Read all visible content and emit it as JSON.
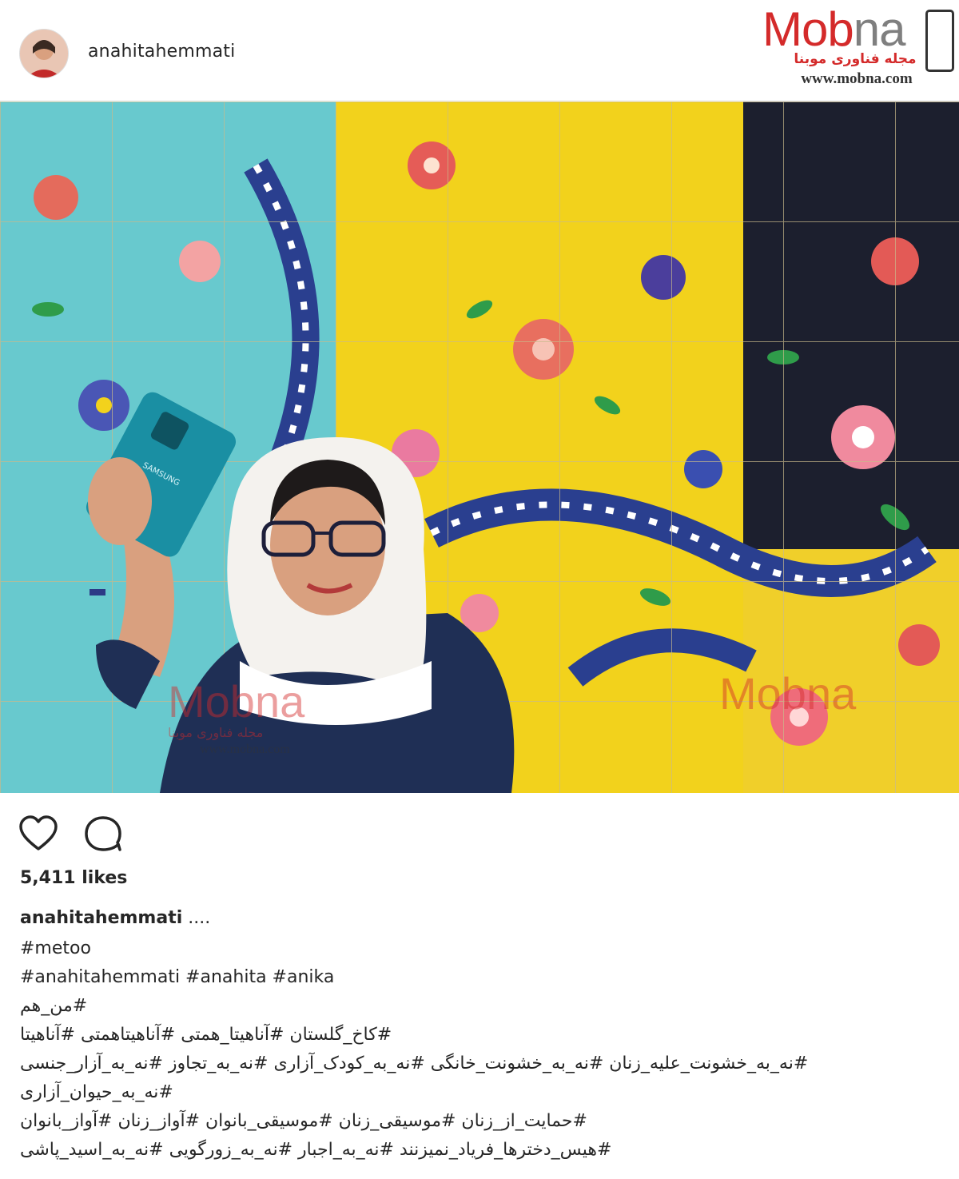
{
  "post": {
    "username": "anahitahemmati",
    "likes_text": "5,411 likes",
    "caption_user": "anahitahemmati",
    "caption_suffix": " ....",
    "caption_lines": [
      "#metoo",
      "#anahitahemmati #anahita #anika",
      "#من_هم",
      "#کاخ_گلستان #آناهیتا_همتی #آناهیتاهمتی #آناهیتا",
      "#نه_به_خشونت_علیه_زنان #نه_به_خشونت_خانگی #نه_به_کودک_آزاری #نه_به_تجاوز #نه_به_آزار_جنسی",
      "#نه_به_حیوان_آزاری",
      "#حمایت_از_زنان #موسیقی_زنان #موسیقی_بانوان #آواز_زنان #آواز_بانوان",
      "#هیس_دخترها_فریاد_نمیزنند #نه_به_اجبار #نه_به_زورگویی #نه_به_اسید_پاشی"
    ]
  },
  "watermark": {
    "brand_main": "Mob",
    "brand_tail": "na",
    "subtitle": "مجله فناوری موبنا",
    "url": "www.mobna.com",
    "overlay_brand": "Mobna",
    "overlay_sub": "مجله فناوری موبنا",
    "overlay_url": "www.mobna.com",
    "phone_brand": "SAMSUNG"
  },
  "icons": {
    "like": "heart-icon",
    "comment": "comment-bubble-icon"
  },
  "colors": {
    "brand_red": "#d42a2a",
    "text": "#262626",
    "tile_yellow": "#f2d21c",
    "tile_blue": "#2a3f8f",
    "phone_teal": "#1a8fa3"
  }
}
